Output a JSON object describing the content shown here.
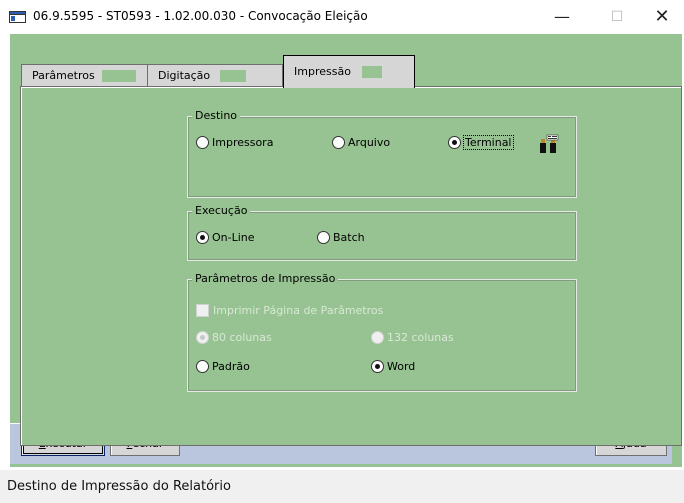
{
  "window": {
    "title": "06.9.5595 - ST0593 - 1.02.00.030 - Convocação Eleição",
    "minimize_glyph": "—",
    "maximize_glyph": "☐",
    "close_glyph": "✕"
  },
  "tabs": [
    {
      "label": "Parâmetros",
      "active": false
    },
    {
      "label": "Digitação",
      "active": false
    },
    {
      "label": "Impressão",
      "active": true
    }
  ],
  "destino": {
    "label": "Destino",
    "options": [
      {
        "label": "Impressora",
        "selected": false
      },
      {
        "label": "Arquivo",
        "selected": false
      },
      {
        "label": "Terminal",
        "selected": true
      }
    ],
    "icon": "printer-setup-icon"
  },
  "execucao": {
    "label": "Execução",
    "options": [
      {
        "label": "On-Line",
        "selected": true
      },
      {
        "label": "Batch",
        "selected": false
      }
    ]
  },
  "parametros_impressao": {
    "label": "Parâmetros de Impressão",
    "checkbox_label": "Imprimir Página de Parâmetros",
    "checkbox_checked": false,
    "columns": [
      {
        "label": "80 colunas",
        "selected": true,
        "disabled": true
      },
      {
        "label": "132 colunas",
        "selected": false,
        "disabled": true
      }
    ],
    "format": [
      {
        "label": "Padrão",
        "selected": false
      },
      {
        "label": "Word",
        "selected": true
      }
    ]
  },
  "buttons": {
    "executar_prefix": "E",
    "executar_rest": "xecutar",
    "fechar_prefix": "F",
    "fechar_rest": "echar",
    "ajuda_prefix": "A",
    "ajuda_rest": "juda"
  },
  "status": {
    "text": "Destino de Impressão do Relatório"
  },
  "colors": {
    "panel_bg": "#97c392",
    "bottom_bar": "#b9c6de"
  }
}
